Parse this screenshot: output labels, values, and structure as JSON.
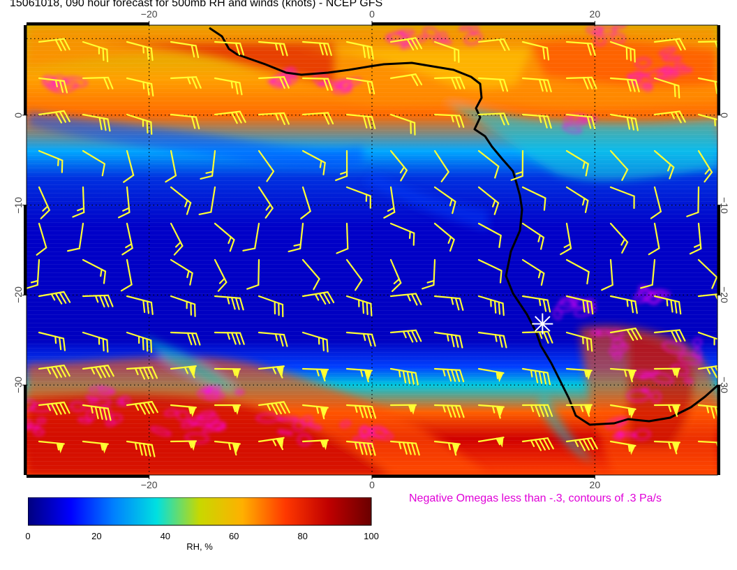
{
  "title": "15061018, 090 hour forecast for 500mb RH and winds (knots) - NCEP GFS",
  "lon_ticks": [
    {
      "lon": -20,
      "label": "−20"
    },
    {
      "lon": 0,
      "label": "0"
    },
    {
      "lon": 20,
      "label": "20"
    }
  ],
  "lat_ticks": [
    {
      "lat": 0,
      "label": "0"
    },
    {
      "lat": -10,
      "label": "−10"
    },
    {
      "lat": -20,
      "label": "−20"
    },
    {
      "lat": -30,
      "label": "−30"
    }
  ],
  "map_extent": {
    "lon_min": -31,
    "lon_max": 31,
    "lat_min": -40,
    "lat_max": 10
  },
  "omega_note": "Negative Omegas less than -.3, contours of .3 Pa/s",
  "colorbar": {
    "label": "RH, %",
    "ticks": [
      "0",
      "20",
      "40",
      "60",
      "80",
      "100"
    ],
    "colors": [
      "#00007f",
      "#0000ff",
      "#0080ff",
      "#00e0e0",
      "#c8d800",
      "#ffb000",
      "#ff3800",
      "#c00000",
      "#6a0000"
    ]
  },
  "colors": {
    "wind_barbs": "#ffff33",
    "omega_contours": "#ff00ff",
    "coastline": "#000000",
    "station_marker": "#ffffff",
    "graticule": "#000000"
  },
  "station_marker": {
    "lon": 15.3,
    "lat": -23.2
  }
}
